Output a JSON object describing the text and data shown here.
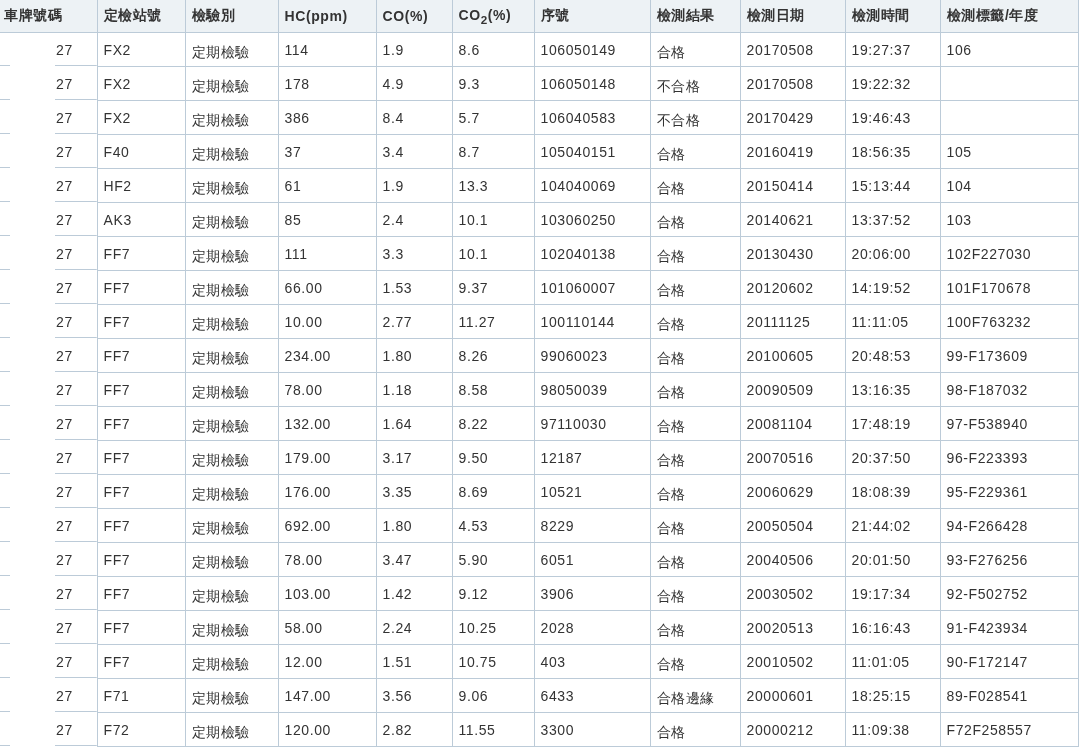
{
  "table": {
    "columns": [
      "車牌號碼",
      "定檢站號",
      "檢驗別",
      "HC(ppm)",
      "CO(%)",
      "CO$_{2}$(%)",
      "序號",
      "檢測結果",
      "檢測日期",
      "檢測時間",
      "檢測標籤/年度"
    ],
    "rows": [
      [
        "27",
        "FX2",
        "定期檢驗",
        "114",
        "1.9",
        "8.6",
        "106050149",
        "合格",
        "20170508",
        "19:27:37",
        "106"
      ],
      [
        "27",
        "FX2",
        "定期檢驗",
        "178",
        "4.9",
        "9.3",
        "106050148",
        "不合格",
        "20170508",
        "19:22:32",
        ""
      ],
      [
        "27",
        "FX2",
        "定期檢驗",
        "386",
        "8.4",
        "5.7",
        "106040583",
        "不合格",
        "20170429",
        "19:46:43",
        ""
      ],
      [
        "27",
        "F40",
        "定期檢驗",
        "37",
        "3.4",
        "8.7",
        "105040151",
        "合格",
        "20160419",
        "18:56:35",
        "105"
      ],
      [
        "27",
        "HF2",
        "定期檢驗",
        "61",
        "1.9",
        "13.3",
        "104040069",
        "合格",
        "20150414",
        "15:13:44",
        "104"
      ],
      [
        "27",
        "AK3",
        "定期檢驗",
        "85",
        "2.4",
        "10.1",
        "103060250",
        "合格",
        "20140621",
        "13:37:52",
        "103"
      ],
      [
        "27",
        "FF7",
        "定期檢驗",
        "111",
        "3.3",
        "10.1",
        "102040138",
        "合格",
        "20130430",
        "20:06:00",
        "102F227030"
      ],
      [
        "27",
        "FF7",
        "定期檢驗",
        "66.00",
        "1.53",
        "9.37",
        "101060007",
        "合格",
        "20120602",
        "14:19:52",
        "101F170678"
      ],
      [
        "27",
        "FF7",
        "定期檢驗",
        "10.00",
        "2.77",
        "11.27",
        "100110144",
        "合格",
        "20111125",
        "11:11:05",
        "100F763232"
      ],
      [
        "27",
        "FF7",
        "定期檢驗",
        "234.00",
        "1.80",
        "8.26",
        "99060023",
        "合格",
        "20100605",
        "20:48:53",
        "99-F173609"
      ],
      [
        "27",
        "FF7",
        "定期檢驗",
        "78.00",
        "1.18",
        "8.58",
        "98050039",
        "合格",
        "20090509",
        "13:16:35",
        "98-F187032"
      ],
      [
        "27",
        "FF7",
        "定期檢驗",
        "132.00",
        "1.64",
        "8.22",
        "97110030",
        "合格",
        "20081104",
        "17:48:19",
        "97-F538940"
      ],
      [
        "27",
        "FF7",
        "定期檢驗",
        "179.00",
        "3.17",
        "9.50",
        "12187",
        "合格",
        "20070516",
        "20:37:50",
        "96-F223393"
      ],
      [
        "27",
        "FF7",
        "定期檢驗",
        "176.00",
        "3.35",
        "8.69",
        "10521",
        "合格",
        "20060629",
        "18:08:39",
        "95-F229361"
      ],
      [
        "27",
        "FF7",
        "定期檢驗",
        "692.00",
        "1.80",
        "4.53",
        "8229",
        "合格",
        "20050504",
        "21:44:02",
        "94-F266428"
      ],
      [
        "27",
        "FF7",
        "定期檢驗",
        "78.00",
        "3.47",
        "5.90",
        "6051",
        "合格",
        "20040506",
        "20:01:50",
        "93-F276256"
      ],
      [
        "27",
        "FF7",
        "定期檢驗",
        "103.00",
        "1.42",
        "9.12",
        "3906",
        "合格",
        "20030502",
        "19:17:34",
        "92-F502752"
      ],
      [
        "27",
        "FF7",
        "定期檢驗",
        "58.00",
        "2.24",
        "10.25",
        "2028",
        "合格",
        "20020513",
        "16:16:43",
        "91-F423934"
      ],
      [
        "27",
        "FF7",
        "定期檢驗",
        "12.00",
        "1.51",
        "10.75",
        "403",
        "合格",
        "20010502",
        "11:01:05",
        "90-F172147"
      ],
      [
        "27",
        "F71",
        "定期檢驗",
        "147.00",
        "3.56",
        "9.06",
        "6433",
        "合格邊緣",
        "20000601",
        "18:25:15",
        "89-F028541"
      ],
      [
        "27",
        "F72",
        "定期檢驗",
        "120.00",
        "2.82",
        "11.55",
        "3300",
        "合格",
        "20000212",
        "11:09:38",
        "F72F258557"
      ]
    ]
  }
}
